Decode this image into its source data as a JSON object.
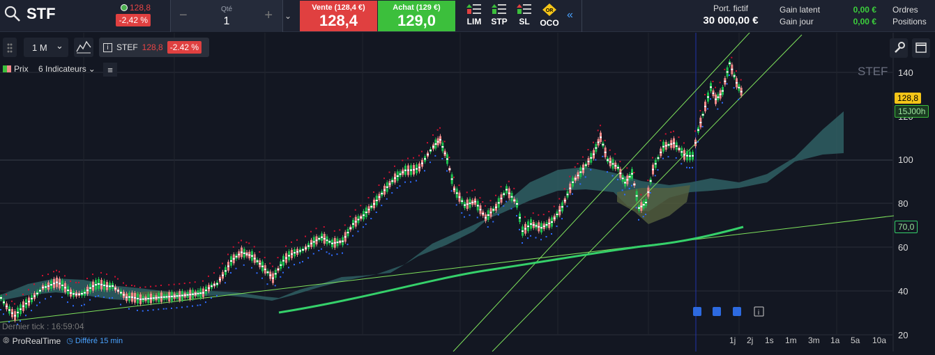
{
  "topbar": {
    "symbol": "STF",
    "last_price": "128,8",
    "change": "-2,42 %",
    "qty_label": "Qté",
    "qty_value": "1",
    "sell_label": "Vente (128,4 €)",
    "sell_value": "128,4",
    "buy_label": "Achat (129 €)",
    "buy_value": "129,0",
    "order_types": [
      "LIM",
      "STP",
      "SL",
      "OCO"
    ],
    "oco_badge": "OR",
    "portfolio_label": "Port. fictif",
    "portfolio_value": "30 000,00 €",
    "gain_latent_label": "Gain latent",
    "gain_jour_label": "Gain jour",
    "gain_latent_value": "0,00 €",
    "gain_jour_value": "0,00 €",
    "orders_label": "Ordres",
    "positions_label": "Positions"
  },
  "toolbar": {
    "timeframe": "1 M",
    "info_symbol": "STEF",
    "info_price": "128,8",
    "info_change": "-2.42 %",
    "price_label": "Prix",
    "indicators_label": "6 Indicateurs"
  },
  "chart": {
    "watermark": "STEF",
    "y_ticks": [
      "140",
      "120",
      "100",
      "80",
      "60",
      "40",
      "20"
    ],
    "price_tag": "128,8",
    "time_tag": "15J00h",
    "ma_tag": "70,0",
    "last_tick": "Dernier tick : 16:59:04",
    "brand": "ProRealTime",
    "delay": "Différé 15 min",
    "timeframes": [
      "1j",
      "2j",
      "1s",
      "1m",
      "3m",
      "1a",
      "5a",
      "10a"
    ]
  },
  "colors": {
    "sell": "#e04040",
    "buy": "#3cbf3c",
    "bull_candle": "#1fbf4f",
    "bear_candle": "#f08a8a",
    "cloud": "#2f5f63",
    "ma_line": "#35d06a",
    "trend_line": "#7fe35c",
    "price_tag": "#f5c518",
    "time_tag": "#3cbf3c",
    "ma_tag_border": "#35d06a"
  },
  "icons": [
    "search-icon",
    "minus-icon",
    "plus-icon",
    "chevron-down-icon",
    "double-chevron-left-icon",
    "wrench-icon",
    "window-icon",
    "info-icon",
    "list-icon",
    "chart-style-icon",
    "grip-icon",
    "news-icon"
  ]
}
